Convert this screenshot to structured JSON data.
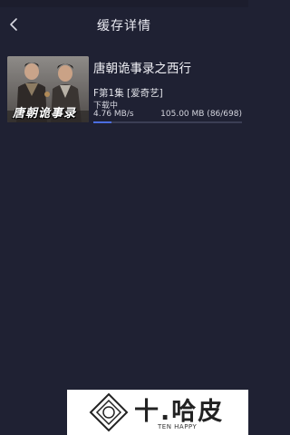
{
  "header": {
    "title": "缓存详情",
    "back_icon": "chevron-left-icon"
  },
  "download": {
    "title": "唐朝诡事录之西行",
    "poster_text": "唐朝诡事录",
    "episode": "F第1集 [爱奇艺]",
    "status": "下载中",
    "speed": "4.76 MB/s",
    "size": "105.00 MB (86/698)",
    "progress_fraction": 0.12,
    "progress_color": "#4b6de0"
  },
  "watermark": {
    "name": "十.哈皮",
    "subtitle": "TEN HAPPY"
  },
  "colors": {
    "background": "#1f2133",
    "text": "#e6e7ee"
  }
}
